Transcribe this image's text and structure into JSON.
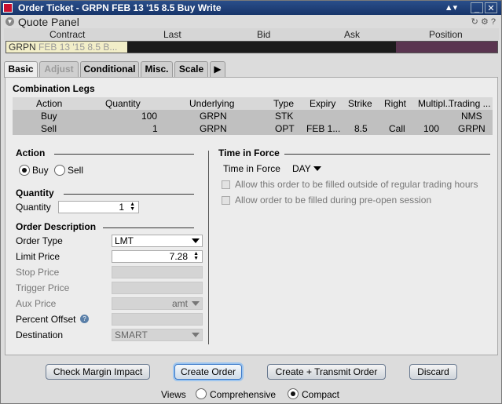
{
  "window": {
    "title": "Order Ticket - GRPN FEB 13 '15  8.5 Buy Write"
  },
  "quote_panel": {
    "label": "Quote Panel",
    "columns": [
      "Contract",
      "Last",
      "Bid",
      "Ask",
      "Position"
    ],
    "contract_main": "GRPN",
    "contract_detail": "FEB 13 '15 8.5 B..."
  },
  "tabs": [
    {
      "label": "Basic",
      "state": "active"
    },
    {
      "label": "Adjust",
      "state": "disabled"
    },
    {
      "label": "Conditional",
      "state": "normal"
    },
    {
      "label": "Misc.",
      "state": "normal"
    },
    {
      "label": "Scale",
      "state": "normal"
    }
  ],
  "legs": {
    "title": "Combination Legs",
    "headers": [
      "Action",
      "Quantity",
      "Underlying",
      "Type",
      "Expiry",
      "Strike",
      "Right",
      "Multipl...",
      "Trading ..."
    ],
    "rows": [
      [
        "Buy",
        "100",
        "GRPN",
        "STK",
        "",
        "",
        "",
        "",
        "NMS"
      ],
      [
        "Sell",
        "1",
        "GRPN",
        "OPT",
        "FEB 1...",
        "8.5",
        "Call",
        "100",
        "GRPN"
      ]
    ]
  },
  "action": {
    "title": "Action",
    "buy": "Buy",
    "sell": "Sell",
    "selected": "Buy"
  },
  "quantity": {
    "title": "Quantity",
    "label": "Quantity",
    "value": "1"
  },
  "order_desc": {
    "title": "Order Description",
    "order_type_label": "Order Type",
    "order_type": "LMT",
    "limit_price_label": "Limit Price",
    "limit_price": "7.28",
    "stop_price_label": "Stop Price",
    "trigger_price_label": "Trigger Price",
    "aux_price_label": "Aux Price",
    "aux_price": "amt",
    "percent_offset_label": "Percent Offset",
    "destination_label": "Destination",
    "destination": "SMART"
  },
  "tif": {
    "title": "Time in Force",
    "label": "Time in Force",
    "value": "DAY",
    "outside_rth": "Allow this order to be filled outside of regular trading hours",
    "pre_open": "Allow order to be filled during pre-open session"
  },
  "buttons": {
    "check_margin": "Check Margin Impact",
    "create_order": "Create Order",
    "create_transmit": "Create + Transmit Order",
    "discard": "Discard"
  },
  "views": {
    "label": "Views",
    "comprehensive": "Comprehensive",
    "compact": "Compact",
    "selected": "Compact"
  }
}
